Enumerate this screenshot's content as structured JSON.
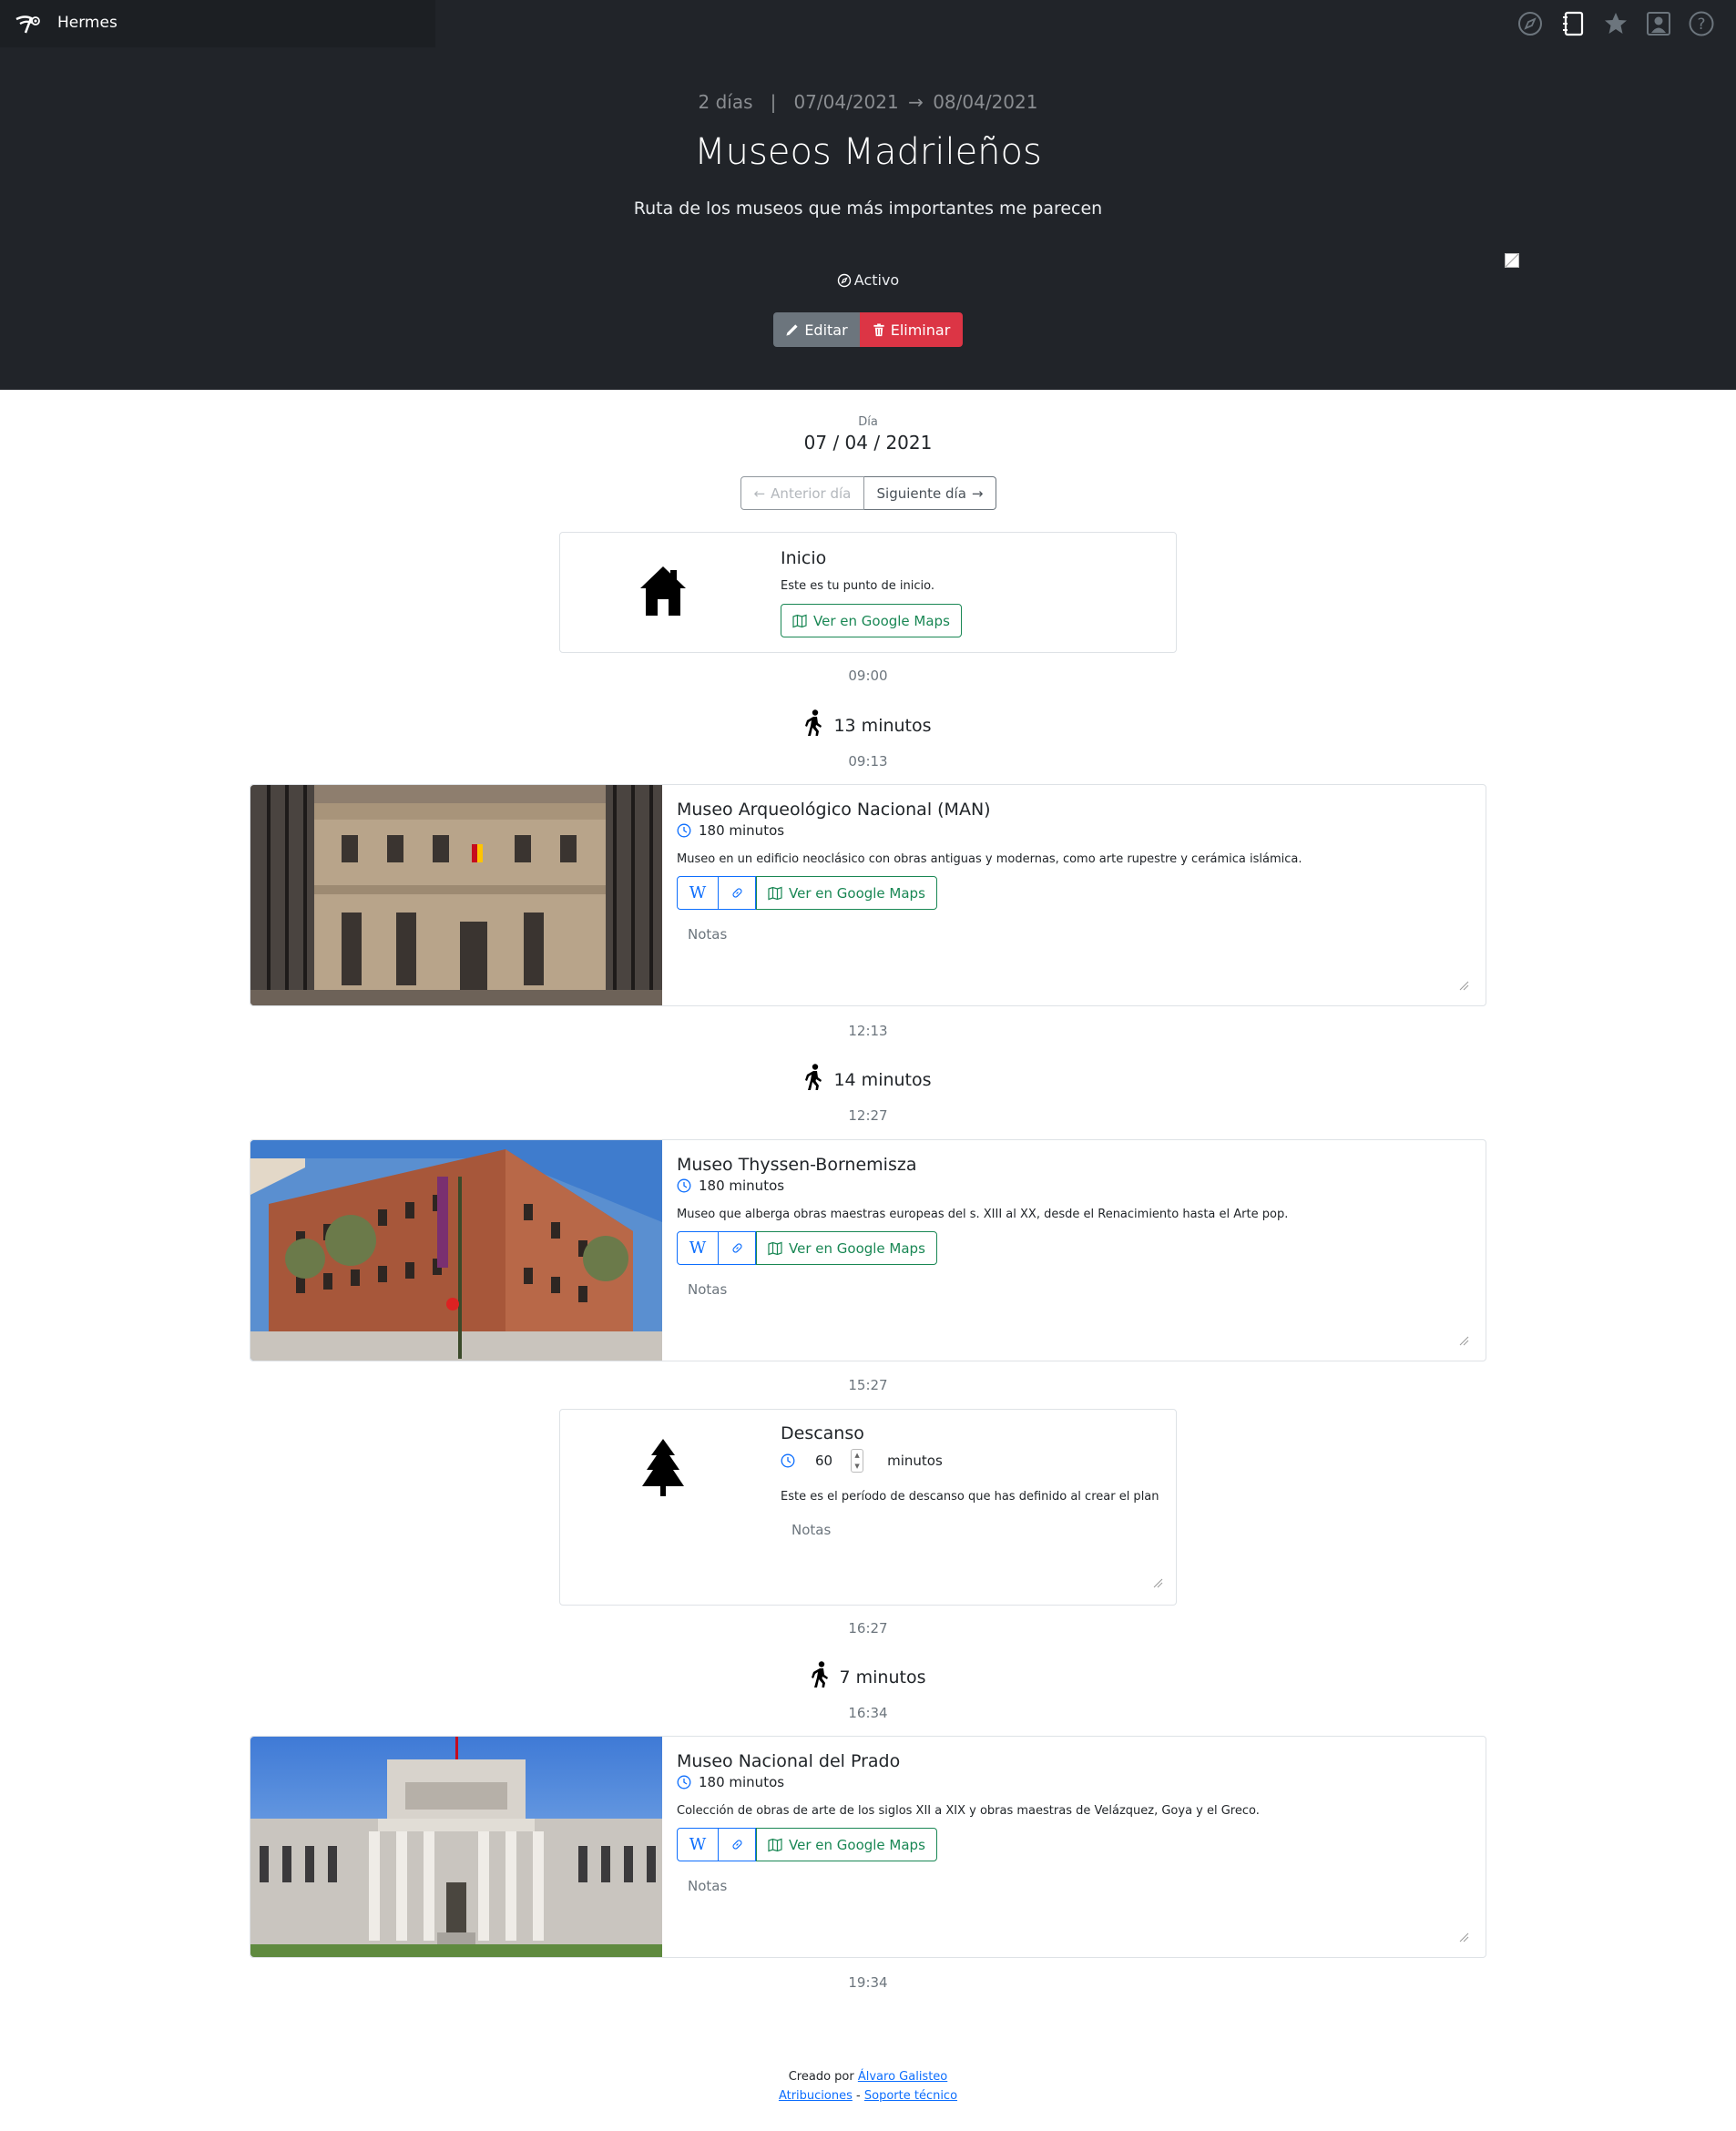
{
  "app": {
    "name": "Hermes"
  },
  "nav": {
    "icons": [
      "compass-icon",
      "notebook-icon",
      "star-icon",
      "profile-icon",
      "help-icon"
    ]
  },
  "plan": {
    "days_text": "2 días",
    "separator": "|",
    "start_date": "07/04/2021",
    "end_date": "08/04/2021",
    "title": "Museos Madrileños",
    "description": "Ruta de los museos que más importantes me parecen",
    "status": "Activo",
    "edit_label": "Editar",
    "delete_label": "Eliminar"
  },
  "day": {
    "label": "Día",
    "date": "07 / 04 / 2021",
    "prev_label": "Anterior día",
    "next_label": "Siguiente día"
  },
  "start": {
    "title": "Inicio",
    "text": "Este es tu punto de inicio.",
    "maps_label": "Ver en Google Maps"
  },
  "times": [
    "09:00",
    "09:13",
    "12:13",
    "12:27",
    "15:27",
    "16:27",
    "16:34",
    "19:34"
  ],
  "walks": [
    "13 minutos",
    "14 minutos",
    "7 minutos"
  ],
  "museums": [
    {
      "title": "Museo Arqueológico Nacional (MAN)",
      "duration": "180 minutos",
      "description": "Museo en un edificio neoclásico con obras antiguas y modernas, como arte rupestre y cerámica islámica.",
      "wiki_label": "W",
      "maps_label": "Ver en Google Maps",
      "notes_placeholder": "Notas"
    },
    {
      "title": "Museo Thyssen-Bornemisza",
      "duration": "180 minutos",
      "description": "Museo que alberga obras maestras europeas del s. XIII al XX, desde el Renacimiento hasta el Arte pop.",
      "wiki_label": "W",
      "maps_label": "Ver en Google Maps",
      "notes_placeholder": "Notas"
    },
    {
      "title": "Museo Nacional del Prado",
      "duration": "180 minutos",
      "description": "Colección de obras de arte de los siglos XII a XIX y obras maestras de Velázquez, Goya y el Greco.",
      "wiki_label": "W",
      "maps_label": "Ver en Google Maps",
      "notes_placeholder": "Notas"
    }
  ],
  "rest": {
    "title": "Descanso",
    "value": "60",
    "unit": "minutos",
    "text": "Este es el período de descanso que has definido al crear el plan",
    "notes_placeholder": "Notas"
  },
  "footer": {
    "created_by": "Creado por",
    "author": "Álvaro Galisteo",
    "attributions": "Atribuciones",
    "dash": "-",
    "support": "Soporte técnico"
  },
  "colors": {
    "dark_bg": "#212429",
    "danger": "#dc3545",
    "secondary": "#6c757d",
    "primary": "#0d6efd",
    "success": "#198754"
  }
}
